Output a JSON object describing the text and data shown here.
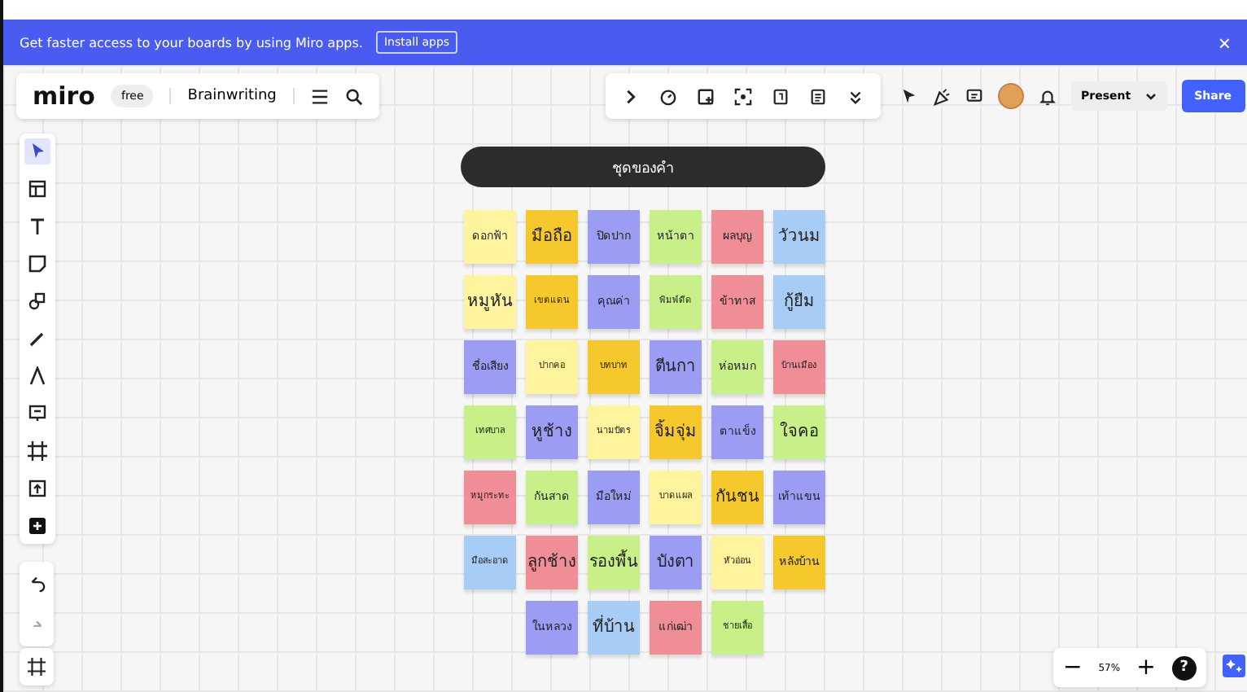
{
  "banner": {
    "text": "Get faster access to your boards by using Miro apps.",
    "button": "Install apps",
    "close": "×"
  },
  "topbar": {
    "logo": "miro",
    "plan": "free",
    "board_name": "Brainwriting"
  },
  "actions": {
    "present": "Present",
    "share": "Share"
  },
  "board": {
    "title": "ชุดของคำ",
    "rows": [
      [
        {
          "text": "ดอกฟ้า",
          "color": "#fff49e",
          "kind": "medium"
        },
        {
          "text": "มือถือ",
          "color": "#f5c92c",
          "kind": "large"
        },
        {
          "text": "ปิดปาก",
          "color": "#9b9df2",
          "kind": "medium"
        },
        {
          "text": "หน้าตา",
          "color": "#c8ef88",
          "kind": "medium"
        },
        {
          "text": "ผลบุญ",
          "color": "#f08e97",
          "kind": "medium"
        },
        {
          "text": "วัวนม",
          "color": "#a7cdf5",
          "kind": "large"
        }
      ],
      [
        {
          "text": "หมูหัน",
          "color": "#fff49e",
          "kind": "large"
        },
        {
          "text": "เขตแดน",
          "color": "#f5c92c",
          "kind": "small"
        },
        {
          "text": "คุณค่า",
          "color": "#9b9df2",
          "kind": "medium"
        },
        {
          "text": "พิมพ์ดีด",
          "color": "#c8ef88",
          "kind": "small"
        },
        {
          "text": "ข้าทาส",
          "color": "#f08e97",
          "kind": "medium"
        },
        {
          "text": "กู้ยืม",
          "color": "#a7cdf5",
          "kind": "large"
        }
      ],
      [
        {
          "text": "ชื่อเสียง",
          "color": "#9b9df2",
          "kind": "medium"
        },
        {
          "text": "ปากคอ",
          "color": "#fff49e",
          "kind": "small"
        },
        {
          "text": "บทบาท",
          "color": "#f5c92c",
          "kind": "small"
        },
        {
          "text": "ตีนกา",
          "color": "#9b9df2",
          "kind": "large"
        },
        {
          "text": "ห่อหมก",
          "color": "#c8ef88",
          "kind": "medium"
        },
        {
          "text": "บ้านเมือง",
          "color": "#f08e97",
          "kind": "small"
        }
      ],
      [
        {
          "text": "เทศบาล",
          "color": "#c8ef88",
          "kind": "small"
        },
        {
          "text": "หูช้าง",
          "color": "#9b9df2",
          "kind": "large"
        },
        {
          "text": "นามบัตร",
          "color": "#fff49e",
          "kind": "small"
        },
        {
          "text": "จิ้มจุ่ม",
          "color": "#f5c92c",
          "kind": "large"
        },
        {
          "text": "ตาแข็ง",
          "color": "#9b9df2",
          "kind": "medium"
        },
        {
          "text": "ใจคอ",
          "color": "#c8ef88",
          "kind": "large"
        }
      ],
      [
        {
          "text": "หมูกระทะ",
          "color": "#f08e97",
          "kind": "small"
        },
        {
          "text": "กันสาด",
          "color": "#c8ef88",
          "kind": "medium"
        },
        {
          "text": "มือใหม่",
          "color": "#9b9df2",
          "kind": "medium"
        },
        {
          "text": "บาดแผล",
          "color": "#fff49e",
          "kind": "small"
        },
        {
          "text": "กันชน",
          "color": "#f5c92c",
          "kind": "large"
        },
        {
          "text": "เท้าแขน",
          "color": "#9b9df2",
          "kind": "medium"
        }
      ],
      [
        {
          "text": "มือสะอาด",
          "color": "#a7cdf5",
          "kind": "small"
        },
        {
          "text": "ลูกช้าง",
          "color": "#f08e97",
          "kind": "large"
        },
        {
          "text": "รองพื้น",
          "color": "#c8ef88",
          "kind": "large"
        },
        {
          "text": "บังตา",
          "color": "#9b9df2",
          "kind": "large"
        },
        {
          "text": "หัวอ่อน",
          "color": "#fff49e",
          "kind": "small"
        },
        {
          "text": "หลังบ้าน",
          "color": "#f5c92c",
          "kind": "medium"
        }
      ]
    ],
    "last_row": [
      {
        "text": "ในหลวง",
        "color": "#9b9df2",
        "kind": "medium"
      },
      {
        "text": "ที่บ้าน",
        "color": "#a7cdf5",
        "kind": "large"
      },
      {
        "text": "แก่เฒ่า",
        "color": "#f08e97",
        "kind": "medium"
      },
      {
        "text": "ชายเสื้อ",
        "color": "#c8ef88",
        "kind": "small"
      }
    ]
  },
  "left_tools": [
    {
      "kind": "cursor",
      "selected": true
    },
    {
      "kind": "template",
      "selected": false
    },
    {
      "kind": "text",
      "selected": false
    },
    {
      "kind": "sticky",
      "selected": false
    },
    {
      "kind": "shapes",
      "selected": false
    },
    {
      "kind": "pen",
      "selected": false
    },
    {
      "kind": "curve",
      "selected": false
    },
    {
      "kind": "comment",
      "selected": false
    },
    {
      "kind": "frame",
      "selected": false
    },
    {
      "kind": "upload",
      "selected": false
    },
    {
      "kind": "plus",
      "selected": false
    }
  ],
  "zoom": {
    "level": "57%",
    "minus": "−",
    "plus": "+",
    "help": "?"
  }
}
